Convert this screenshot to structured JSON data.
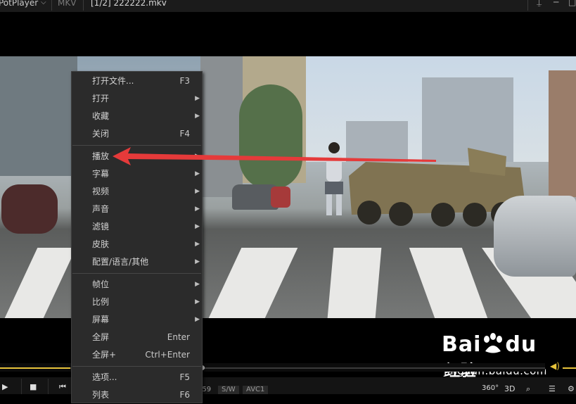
{
  "titlebar": {
    "app_name": "PotPlayer",
    "format": "MKV",
    "file_name": "[1/2] 222222.mkv"
  },
  "menu": {
    "items": [
      {
        "label": "打开文件...",
        "shortcut": "F3",
        "submenu": false
      },
      {
        "label": "打开",
        "shortcut": "",
        "submenu": true
      },
      {
        "label": "收藏",
        "shortcut": "",
        "submenu": true
      },
      {
        "label": "关闭",
        "shortcut": "F4",
        "submenu": false
      },
      {
        "label": "播放",
        "shortcut": "",
        "submenu": true
      },
      {
        "label": "字幕",
        "shortcut": "",
        "submenu": true
      },
      {
        "label": "视频",
        "shortcut": "",
        "submenu": true
      },
      {
        "label": "声音",
        "shortcut": "",
        "submenu": true
      },
      {
        "label": "滤镜",
        "shortcut": "",
        "submenu": true
      },
      {
        "label": "皮肤",
        "shortcut": "",
        "submenu": true
      },
      {
        "label": "配置/语言/其他",
        "shortcut": "",
        "submenu": true
      },
      {
        "label": "帧位",
        "shortcut": "",
        "submenu": true
      },
      {
        "label": "比例",
        "shortcut": "",
        "submenu": true
      },
      {
        "label": "屏幕",
        "shortcut": "",
        "submenu": true
      },
      {
        "label": "全屏",
        "shortcut": "Enter",
        "submenu": false
      },
      {
        "label": "全屏+",
        "shortcut": "Ctrl+Enter",
        "submenu": false
      },
      {
        "label": "选项...",
        "shortcut": "F5",
        "submenu": false
      },
      {
        "label": "列表",
        "shortcut": "F6",
        "submenu": false
      }
    ]
  },
  "controls": {
    "time_fragment": ":59",
    "badge_sw": "S/W",
    "badge_codec": "AVC1",
    "btn_360": "360°",
    "btn_3d": "3D"
  },
  "watermark": {
    "brand": "Bai",
    "brand2": "du",
    "cn": "经验",
    "url": "jingyan.baidu.com"
  },
  "colors": {
    "accent": "#e7c33b",
    "menu_bg": "#2b2b2b",
    "annotation": "#e53a3a"
  },
  "seek_progress": 0.37
}
